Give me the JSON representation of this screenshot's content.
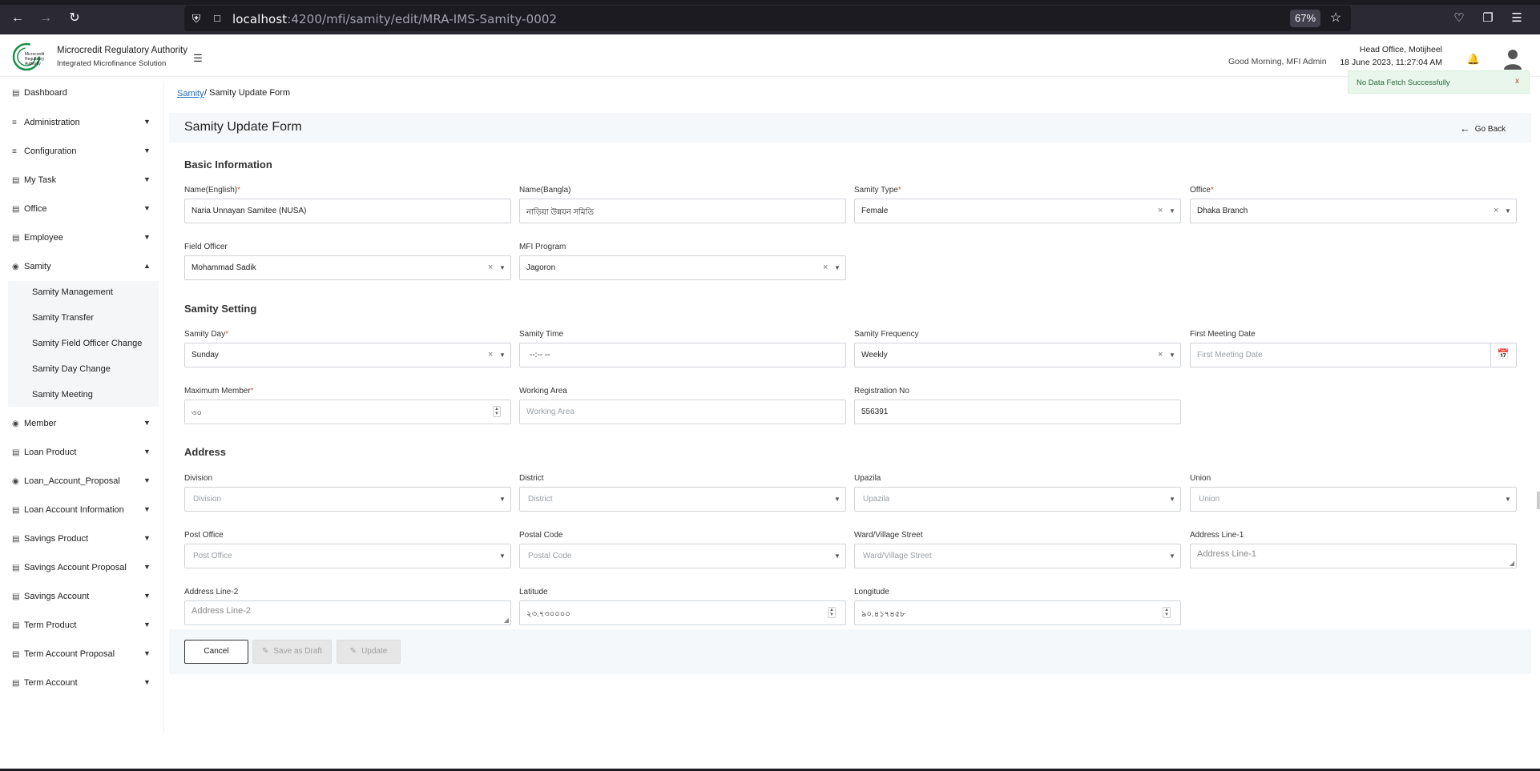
{
  "browser": {
    "url_host": "localhost",
    "url_path": ":4200/mfi/samity/edit/MRA-IMS-Samity-0002",
    "zoom": "67%"
  },
  "header": {
    "org_name": "Microcredit Regulatory Authority",
    "org_sub": "Integrated Microfinance Solution",
    "logo_text_1": "Microcredit",
    "logo_text_2": "Regulatory",
    "logo_text_3": "Authority",
    "greeting": "Good Morning, MFI Admin",
    "office": "Head Office, Motijheel",
    "datetime": "18 June 2023, 11:27:04 AM"
  },
  "sidebar": {
    "dashboard": "Dashboard",
    "items": [
      {
        "label": "Administration"
      },
      {
        "label": "Configuration"
      },
      {
        "label": "My Task"
      },
      {
        "label": "Office"
      },
      {
        "label": "Employee"
      },
      {
        "label": "Samity"
      },
      {
        "label": "Member"
      },
      {
        "label": "Loan Product"
      },
      {
        "label": "Loan_Account_Proposal"
      },
      {
        "label": "Loan Account Information"
      },
      {
        "label": "Savings Product"
      },
      {
        "label": "Savings Account Proposal"
      },
      {
        "label": "Savings Account"
      },
      {
        "label": "Term Product"
      },
      {
        "label": "Term Account Proposal"
      },
      {
        "label": "Term Account"
      }
    ],
    "samity_sub": [
      {
        "label": "Samity Management"
      },
      {
        "label": "Samity Transfer"
      },
      {
        "label": "Samity Field Officer Change"
      },
      {
        "label": "Samity Day Change"
      },
      {
        "label": "Samity Meeting"
      }
    ]
  },
  "breadcrumb": {
    "link": "Samity",
    "rest": "/ Samity Update Form"
  },
  "toast": {
    "message": "No Data Fetch Successfully",
    "close": "x"
  },
  "form": {
    "title": "Samity Update Form",
    "go_back": "Go Back",
    "sections": {
      "basic": "Basic Information",
      "setting": "Samity Setting",
      "address": "Address"
    },
    "fields": {
      "name_en": {
        "label": "Name(English)",
        "value": "Naria Unnayan Samitee (NUSA)"
      },
      "name_bn": {
        "label": "Name(Bangla)",
        "value": "নাড়িয়া উন্নয়ন সমিতি"
      },
      "samity_type": {
        "label": "Samity Type",
        "value": "Female"
      },
      "office": {
        "label": "Office",
        "value": "Dhaka Branch"
      },
      "field_officer": {
        "label": "Field Officer",
        "value": "Mohammad Sadik"
      },
      "mfi_program": {
        "label": "MFI Program",
        "value": "Jagoron"
      },
      "samity_day": {
        "label": "Samity Day",
        "value": "Sunday"
      },
      "samity_time": {
        "label": "Samity Time",
        "value": "--:-- --"
      },
      "samity_frequency": {
        "label": "Samity Frequency",
        "value": "Weekly"
      },
      "first_meeting_date": {
        "label": "First Meeting Date",
        "placeholder": "First Meeting Date"
      },
      "max_member": {
        "label": "Maximum Member",
        "value": "৩০"
      },
      "working_area": {
        "label": "Working Area",
        "placeholder": "Working Area"
      },
      "registration_no": {
        "label": "Registration No",
        "value": "556391"
      },
      "division": {
        "label": "Division",
        "placeholder": "Division"
      },
      "district": {
        "label": "District",
        "placeholder": "District"
      },
      "upazila": {
        "label": "Upazila",
        "placeholder": "Upazila"
      },
      "union": {
        "label": "Union",
        "placeholder": "Union"
      },
      "post_office": {
        "label": "Post Office",
        "placeholder": "Post Office"
      },
      "postal_code": {
        "label": "Postal Code",
        "placeholder": "Postal Code"
      },
      "ward": {
        "label": "Ward/Village Street",
        "placeholder": "Ward/Village Street"
      },
      "address1": {
        "label": "Address Line-1",
        "placeholder": "Address Line-1"
      },
      "address2": {
        "label": "Address Line-2",
        "placeholder": "Address Line-2"
      },
      "latitude": {
        "label": "Latitude",
        "value": "২৩.৭৩০০০০"
      },
      "longitude": {
        "label": "Longitude",
        "value": "৯০.৪১৭৪৫৮"
      }
    },
    "buttons": {
      "cancel": "Cancel",
      "draft": "Save as Draft",
      "update": "Update"
    }
  }
}
